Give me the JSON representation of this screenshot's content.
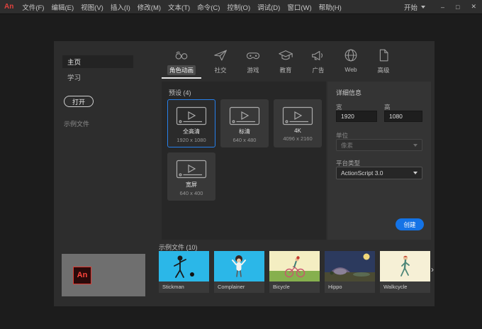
{
  "titlebar": {
    "app_logo": "An",
    "menus": [
      {
        "label": "文件(F)"
      },
      {
        "label": "编辑(E)"
      },
      {
        "label": "视图(V)"
      },
      {
        "label": "插入(I)"
      },
      {
        "label": "修改(M)"
      },
      {
        "label": "文本(T)"
      },
      {
        "label": "命令(C)"
      },
      {
        "label": "控制(O)"
      },
      {
        "label": "调试(D)"
      },
      {
        "label": "窗口(W)"
      },
      {
        "label": "帮助(H)"
      }
    ],
    "workspace": "开始",
    "window_controls": {
      "minimize": "–",
      "maximize": "□",
      "close": "✕"
    }
  },
  "sidebar": {
    "items": [
      {
        "label": "主页",
        "selected": true
      },
      {
        "label": "学习",
        "selected": false
      }
    ],
    "open_button": "打开",
    "files_label": "示例文件"
  },
  "tabs": [
    {
      "label": "角色动画",
      "icon": "character-icon",
      "selected": true
    },
    {
      "label": "社交",
      "icon": "paper-plane-icon",
      "selected": false
    },
    {
      "label": "游戏",
      "icon": "game-controller-icon",
      "selected": false
    },
    {
      "label": "教育",
      "icon": "graduation-cap-icon",
      "selected": false
    },
    {
      "label": "广告",
      "icon": "megaphone-icon",
      "selected": false
    },
    {
      "label": "Web",
      "icon": "globe-icon",
      "selected": false
    },
    {
      "label": "高级",
      "icon": "document-icon",
      "selected": false
    }
  ],
  "presets": {
    "header": "预设 (4)",
    "items": [
      {
        "name": "全高清",
        "dims": "1920 x 1080",
        "selected": true
      },
      {
        "name": "标清",
        "dims": "640 x 480",
        "selected": false
      },
      {
        "name": "4K",
        "dims": "4096 x 2160",
        "selected": false
      },
      {
        "name": "宽屏",
        "dims": "640 x 400",
        "selected": false
      }
    ]
  },
  "details": {
    "header": "详细信息",
    "width_label": "宽",
    "width_value": "1920",
    "height_label": "高",
    "height_value": "1080",
    "units_label": "单位",
    "units_value": "像素",
    "platform_label": "平台类型",
    "platform_value": "ActionScript 3.0",
    "create_button": "创建"
  },
  "samples": {
    "header": "示例文件 (10)",
    "next_glyph": "›",
    "items": [
      {
        "name": "Stickman"
      },
      {
        "name": "Complainer"
      },
      {
        "name": "Bicycle"
      },
      {
        "name": "Hippo"
      },
      {
        "name": "Walkcycle"
      }
    ]
  },
  "colors": {
    "accent_blue": "#1473e6",
    "selection_border": "#2680eb",
    "brand_red": "#e0413d",
    "titlebar_bg": "#2e2e2e",
    "dialog_bg": "#2d2d2d",
    "panel_bg": "#272727"
  }
}
